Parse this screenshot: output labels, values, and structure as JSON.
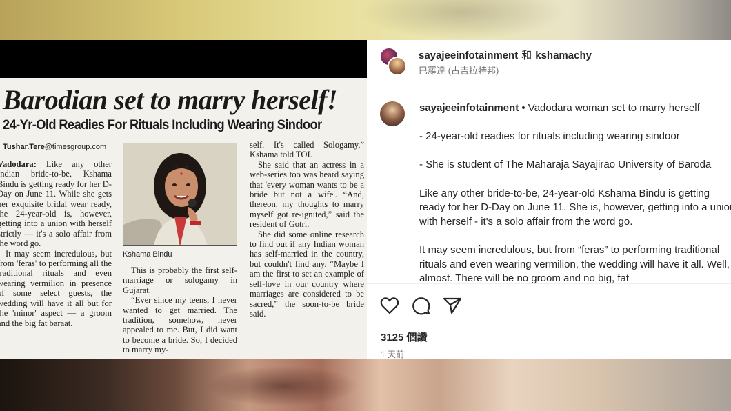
{
  "post": {
    "author": "sayajeeinfotainment",
    "connector": "和",
    "coauthor": "kshamachy",
    "location": "巴羅達 (古吉拉特邦)"
  },
  "caption": {
    "username": "sayajeeinfotainment",
    "title": " • Vadodara woman set to marry herself",
    "paragraphs": [
      "- 24-year-old readies for rituals including wearing sindoor",
      "- She is student of The Maharaja Sayajirao University of Baroda",
      "Like any other bride-to-be, 24-year-old Kshama Bindu is getting ready for her D-Day on June 11. She is, however, getting into a union with herself - it's a solo affair from the word go.",
      "It may seem incredulous, but from “feras” to performing traditional rituals and even wearing vermilion, the wedding will have it all. Well, almost. There will be no groom and no big, fat"
    ]
  },
  "stats": {
    "likes": "3125 個讚",
    "time_ago": "1 天前"
  },
  "icons": {
    "like": "heart-icon",
    "comment": "comment-bubble-icon",
    "share": "paper-plane-icon",
    "user": "user-silhouette-icon"
  },
  "clipping": {
    "headline": "Barodian set to marry herself!",
    "subhead": "24-Yr-Old Readies For Rituals Including Wearing Sindoor",
    "byline_name": "Tushar.Tere",
    "byline_domain": "@timesgroup.com",
    "photo_caption": "Kshama Bindu",
    "col1_lead": "Vadodara:",
    "col1_p1": " Like any other Indian bride-to-be, Kshama Bindu is getting ready for her D-Day on June 11. While she gets her exquisite bridal wear ready, the 24-year-old is, however, getting into a union with herself strictly — it's a solo affair from the word go.",
    "col1_p2": "It may seem incredulous, but from 'feras' to performing all the traditional rituals and even wearing vermilion in presence of some select guests, the wedding will have it all but for the 'minor' aspect — a groom and the big fat baraat.",
    "col2_p1": "This is probably the first self-marriage or sologamy in Gujarat.",
    "col2_p2": "“Ever since my teens, I never wanted to get married. The tradition, somehow, never appealed to me. But, I did want to become a bride. So, I decided to marry my-",
    "col3_p1": "self. It's called Sologamy,” Kshama told TOI.",
    "col3_p2": "She said that an actress in a web-series too was heard saying that 'every woman wants to be a bride but not a wife'. “And, thereon, my thoughts to marry myself got re-ignited,” said the resident of Gotri.",
    "col3_p3": "She did some online research to find out if any Indian woman has self-married in the country, but couldn't find any. “Maybe I am the first to set an example of self-love in our country where marriages are considered to be sacred,” the soon-to-be bride said."
  },
  "colors": {
    "text_primary": "#262626",
    "text_secondary": "#737373",
    "divider": "#efefef"
  }
}
